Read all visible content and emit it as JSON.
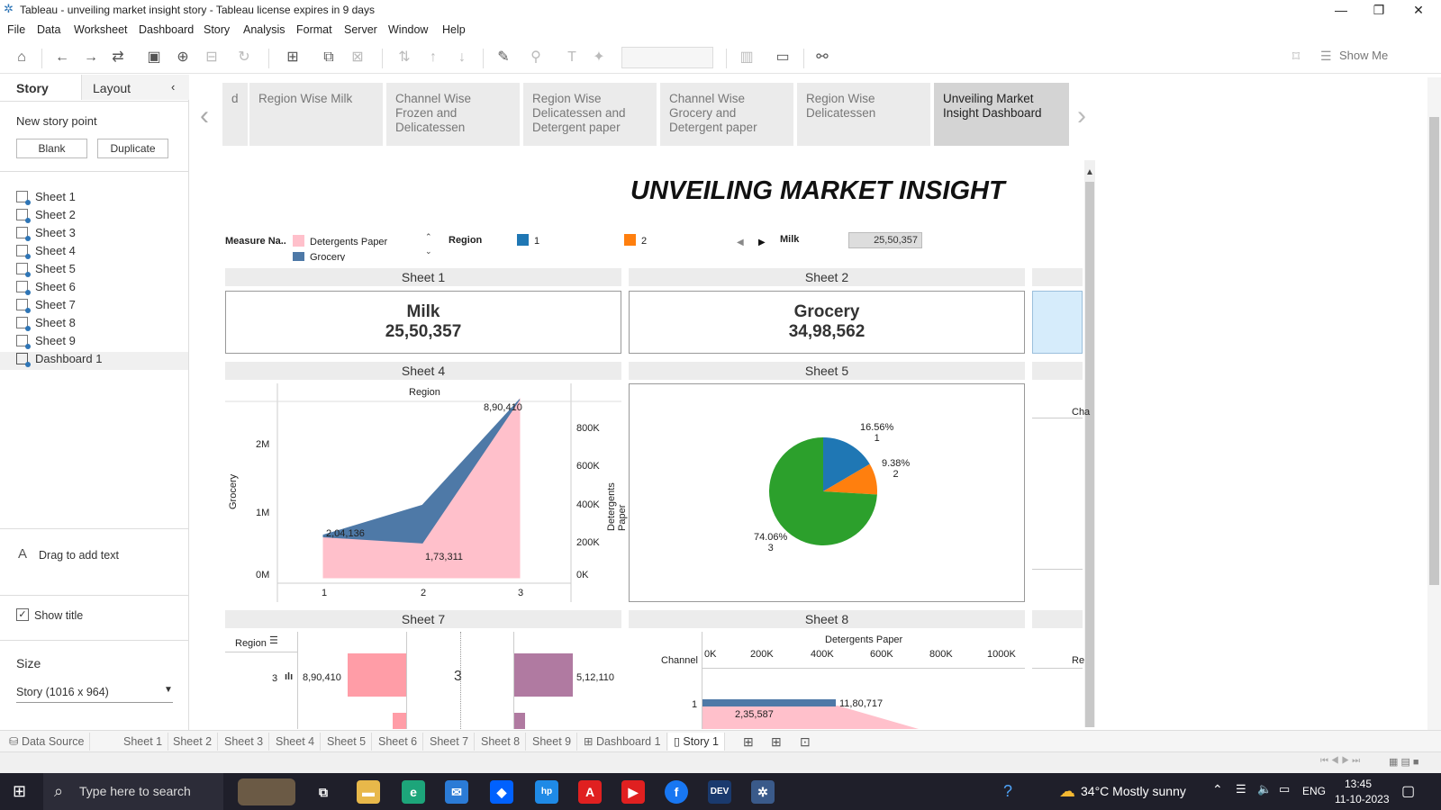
{
  "window": {
    "title": "Tableau - unveiling market insight  story - Tableau license expires in 9 days",
    "controls": [
      "minimize-icon",
      "restore-icon",
      "close-icon"
    ]
  },
  "menu": [
    "File",
    "Data",
    "Worksheet",
    "Dashboard",
    "Story",
    "Analysis",
    "Format",
    "Server",
    "Window",
    "Help"
  ],
  "toolbar": {
    "show_me": "Show Me"
  },
  "left_pane": {
    "tab_story": "Story",
    "tab_layout": "Layout",
    "new_story_point": "New story point",
    "blank": "Blank",
    "duplicate": "Duplicate",
    "sheets": [
      "Sheet 1",
      "Sheet 2",
      "Sheet 3",
      "Sheet 4",
      "Sheet 5",
      "Sheet 6",
      "Sheet 7",
      "Sheet 8",
      "Sheet 9",
      "Dashboard 1"
    ],
    "drag_text": "Drag to add text",
    "show_title": "Show title",
    "size_label": "Size",
    "size_value": "Story (1016 x 964)"
  },
  "story_points": [
    {
      "label": "d"
    },
    {
      "label": "Region Wise Milk"
    },
    {
      "label": "Channel Wise Frozen and Delicatessen"
    },
    {
      "label": "Region Wise Delicatessen and Detergent paper"
    },
    {
      "label": "Channel Wise Grocery and Detergent paper"
    },
    {
      "label": "Region Wise Delicatessen"
    },
    {
      "label": "Unveiling Market Insight Dashboard"
    }
  ],
  "dashboard": {
    "title": "UNVEILING MARKET INSIGHT",
    "legend_measure": "Measure Na..",
    "legend_items": [
      "Detergents Paper",
      "Grocery"
    ],
    "legend_region": "Region",
    "region_items": [
      "1",
      "2"
    ],
    "milk_label": "Milk",
    "milk_value": "25,50,357",
    "sheet_titles": [
      "Sheet 1",
      "Sheet 2",
      "Sheet 4",
      "Sheet 5",
      "Sheet 7",
      "Sheet 8"
    ],
    "kpi1": {
      "name": "Milk",
      "value": "25,50,357"
    },
    "kpi2": {
      "name": "Grocery",
      "value": "34,98,562"
    },
    "sheet4": {
      "header": "Region",
      "left_axis": "Grocery",
      "right_axis": "Detergents Paper",
      "left_ticks": [
        "2M",
        "1M",
        "0M"
      ],
      "right_ticks": [
        "800K",
        "600K",
        "400K",
        "200K",
        "0K"
      ],
      "x_ticks": [
        "1",
        "2",
        "3"
      ],
      "labels": [
        "8,90,410",
        "2,04,136",
        "1,73,311"
      ]
    },
    "sheet5": {
      "labels": [
        {
          "pct": "16.56%",
          "region": "1"
        },
        {
          "pct": "9.38%",
          "region": "2"
        },
        {
          "pct": "74.06%",
          "region": "3"
        }
      ]
    },
    "sheet7": {
      "region_label": "Region",
      "row": "3",
      "center": "3",
      "left_value": "8,90,410",
      "right_value": "5,12,110"
    },
    "sheet8": {
      "axis_title": "Detergents Paper",
      "channel_label": "Channel",
      "ticks": [
        "0K",
        "200K",
        "400K",
        "600K",
        "800K",
        "1000K"
      ],
      "row": "1",
      "value1": "11,80,717",
      "value2": "2,35,587"
    },
    "partial_labels": [
      "Cha",
      "Re"
    ]
  },
  "chart_data": [
    {
      "type": "area",
      "title": "Sheet 4",
      "categories": [
        "1",
        "2",
        "3"
      ],
      "xlabel": "Region",
      "series": [
        {
          "name": "Detergents Paper",
          "values": [
            204136,
            173311,
            890410
          ]
        }
      ],
      "ylabel": "Grocery",
      "ylim": [
        0,
        2500000
      ],
      "y2label": "Detergents Paper",
      "y2lim": [
        0,
        880000
      ]
    },
    {
      "type": "pie",
      "title": "Sheet 5",
      "categories": [
        "1",
        "2",
        "3"
      ],
      "values": [
        16.56,
        9.38,
        74.06
      ],
      "colors": [
        "#1f77b4",
        "#ff7f0e",
        "#2ca02c"
      ]
    }
  ],
  "bottom_tabs": [
    "Data Source",
    "Sheet 1",
    "Sheet 2",
    "Sheet 3",
    "Sheet 4",
    "Sheet 5",
    "Sheet 6",
    "Sheet 7",
    "Sheet 8",
    "Sheet 9",
    "Dashboard 1",
    "Story 1"
  ],
  "taskbar": {
    "search_placeholder": "Type here to search",
    "weather": "34°C  Mostly sunny",
    "lang": "ENG",
    "time": "13:45",
    "date": "11-10-2023"
  },
  "colors": {
    "grocery": "#4e79a7",
    "detergents": "#ffc0cb",
    "region1": "#1f77b4",
    "region2": "#ff7f0e",
    "region3": "#2ca02c"
  }
}
